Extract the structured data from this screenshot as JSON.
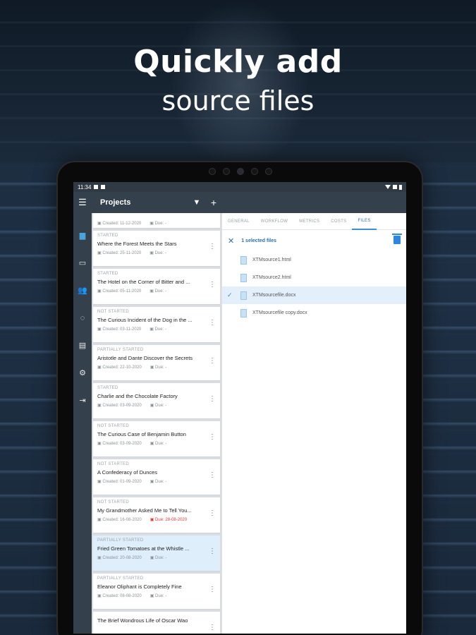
{
  "headline": {
    "line1": "Quickly add",
    "line2": "source files"
  },
  "status_bar": {
    "time": "11:34"
  },
  "app_bar": {
    "title": "Projects",
    "menu_icon": "hamburger-icon",
    "filter_icon": "filter-icon",
    "add_icon": "plus-icon"
  },
  "rail": [
    {
      "icon": "document-icon",
      "active": true
    },
    {
      "icon": "briefcase-icon",
      "active": false
    },
    {
      "icon": "people-icon",
      "active": false
    },
    {
      "icon": "refresh-icon",
      "active": false
    },
    {
      "icon": "file-icon",
      "active": false
    },
    {
      "icon": "gear-icon",
      "active": false
    },
    {
      "icon": "logout-icon",
      "active": false
    }
  ],
  "projects": [
    {
      "status": "",
      "name": "",
      "created": "Created: 11-12-2020",
      "due": "Due: -",
      "due_overdue": false,
      "first": true
    },
    {
      "status": "STARTED",
      "name": "Where the Forest Meets the Stars",
      "created": "Created: 25-11-2020",
      "due": "Due: -",
      "due_overdue": false
    },
    {
      "status": "STARTED",
      "name": "The Hotel on the Corner of Bitter and ...",
      "created": "Created: 05-11-2020",
      "due": "Due: -",
      "due_overdue": false
    },
    {
      "status": "NOT STARTED",
      "name": "The Curious Incident of the Dog in the ...",
      "created": "Created: 03-11-2020",
      "due": "Due: -",
      "due_overdue": false
    },
    {
      "status": "PARTIALLY STARTED",
      "name": "Aristotle and Dante Discover the Secrets",
      "created": "Created: 22-10-2020",
      "due": "Due: -",
      "due_overdue": false
    },
    {
      "status": "STARTED",
      "name": "Charlie and the Chocolate Factory",
      "created": "Created: 03-09-2020",
      "due": "Due: -",
      "due_overdue": false
    },
    {
      "status": "NOT STARTED",
      "name": "The Curious Case of Benjamin Button",
      "created": "Created: 03-09-2020",
      "due": "Due: -",
      "due_overdue": false
    },
    {
      "status": "NOT STARTED",
      "name": "A Confederacy of Dunces",
      "created": "Created: 01-09-2020",
      "due": "Due: -",
      "due_overdue": false
    },
    {
      "status": "NOT STARTED",
      "name": "My Grandmother Asked Me to Tell You...",
      "created": "Created: 16-08-2020",
      "due": "Due: 28-08-2020",
      "due_overdue": true
    },
    {
      "status": "PARTIALLY STARTED",
      "name": "Fried Green Tomatoes at the Whistle ...",
      "created": "Created: 20-08-2020",
      "due": "Due: -",
      "due_overdue": false,
      "selected": true
    },
    {
      "status": "PARTIALLY STARTED",
      "name": "Eleanor Oliphant is Completely Fine",
      "created": "Created: 08-08-2020",
      "due": "Due: -",
      "due_overdue": false
    },
    {
      "status": "",
      "name": "The Brief Wondrous Life of Oscar Wao",
      "created": "",
      "due": "",
      "due_overdue": false
    }
  ],
  "detail": {
    "tabs": [
      "GENERAL",
      "WORKFLOW",
      "METRICS",
      "COSTS",
      "FILES"
    ],
    "active_tab": "FILES",
    "selection_label": "1 selected files",
    "close_icon": "close-icon",
    "delete_icon": "trash-icon",
    "files": [
      {
        "name": "XTMsource1.html",
        "selected": false
      },
      {
        "name": "XTMsource2.html",
        "selected": false
      },
      {
        "name": "XTMsourcefile.docx",
        "selected": true
      },
      {
        "name": "XTMsourcefile copy.docx",
        "selected": false
      }
    ]
  },
  "colors": {
    "accent": "#2e86de",
    "appbar": "#34414d",
    "overdue": "#e53935",
    "selected_bg": "#dfeefb"
  }
}
